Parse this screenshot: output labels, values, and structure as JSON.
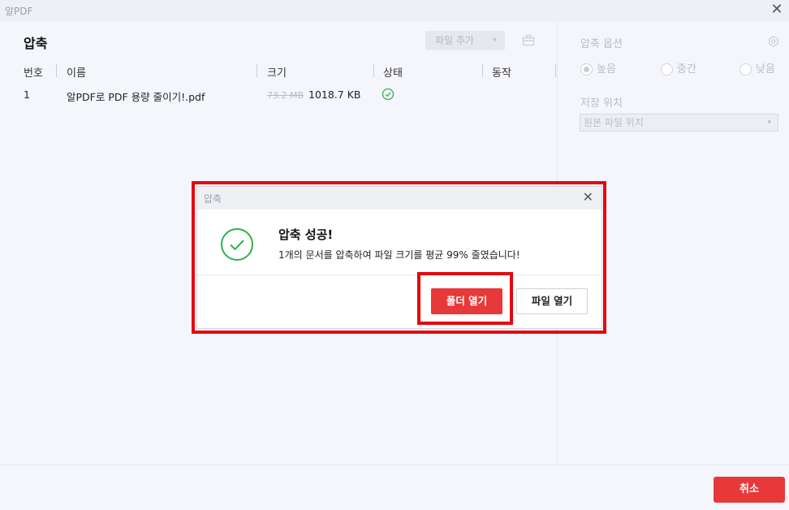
{
  "app": {
    "title": "알PDF"
  },
  "main": {
    "title": "압축",
    "add_file_label": "파일 추가",
    "columns": [
      "번호",
      "이름",
      "크기",
      "상태",
      "동작"
    ],
    "rows": [
      {
        "num": "1",
        "name": "알PDF로 PDF 용량 줄이기!.pdf",
        "old_size": "73.2 MB",
        "new_size": "1018.7 KB"
      }
    ]
  },
  "side": {
    "options_title": "압축 옵션",
    "levels": [
      {
        "label": "높음",
        "selected": true
      },
      {
        "label": "중간",
        "selected": false
      },
      {
        "label": "낮음",
        "selected": false
      }
    ],
    "location_title": "저장 위치",
    "location_value": "원본 파일 위치"
  },
  "dialog": {
    "title": "압축",
    "message_title": "압축 성공!",
    "message": "1개의 문서를 압축하여 파일 크기를 평균 99% 줄였습니다!",
    "open_folder_label": "폴더 열기",
    "open_file_label": "파일 열기"
  },
  "footer": {
    "cancel_label": "취소"
  },
  "colors": {
    "accent": "#e8393a",
    "success": "#2db34a",
    "highlight": "#e4080f"
  }
}
